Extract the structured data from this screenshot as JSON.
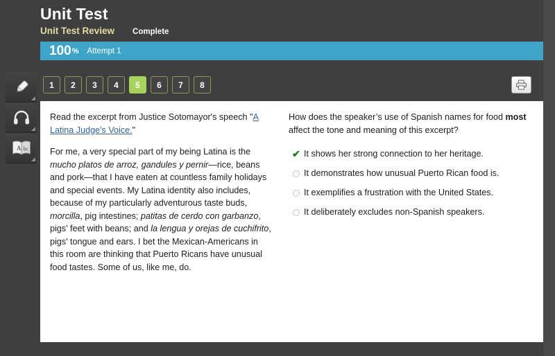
{
  "header": {
    "title": "Unit Test",
    "review_label": "Unit Test Review",
    "status": "Complete",
    "score": "100",
    "percent_symbol": "%",
    "attempt": "Attempt 1",
    "bar_color": "#3ea5c8",
    "review_color": "#e4dca4"
  },
  "tools": [
    {
      "name": "highlighter-tool",
      "label": "Highlighter"
    },
    {
      "name": "audio-tool",
      "label": "Text to speech"
    },
    {
      "name": "dictionary-tool",
      "label": "Dictionary"
    }
  ],
  "question_nav": {
    "items": [
      "1",
      "2",
      "3",
      "4",
      "5",
      "6",
      "7",
      "8"
    ],
    "active": "5",
    "active_color": "#a8d25e",
    "border_color": "#8f9a56"
  },
  "toolbar": {
    "print_label": "Print"
  },
  "passage": {
    "instruction_before": "Read the excerpt from Justice Sotomayor's speech \"",
    "link_text": "A Latina Judge's Voice.",
    "instruction_after": "\"",
    "body_parts": [
      {
        "text": "For me, a very special part of my being Latina is the ",
        "italic": false
      },
      {
        "text": "mucho platos de arroz, gandules y pernir",
        "italic": true
      },
      {
        "text": "—rice, beans and pork—that I have eaten at countless family holidays and special events. My Latina identity also includes, because of my particularly adventurous taste buds, ",
        "italic": false
      },
      {
        "text": "morcilla",
        "italic": true
      },
      {
        "text": ", pig intestines; ",
        "italic": false
      },
      {
        "text": "patitas de cerdo con garbanzo",
        "italic": true
      },
      {
        "text": ", pigs' feet with beans; and ",
        "italic": false
      },
      {
        "text": "la lengua y orejas de cuchifrito",
        "italic": true
      },
      {
        "text": ", pigs' tongue and ears. I bet the Mexican-Americans in this room are thinking that Puerto Ricans have unusual food tastes. Some of us, like me, do.",
        "italic": false
      }
    ]
  },
  "question": {
    "text_before": "How does the speaker’s use of Spanish names for food ",
    "emphasis": "most",
    "text_after": " affect the tone and meaning of this excerpt?",
    "options": [
      {
        "text": "It shows her strong connection to her heritage.",
        "state": "correct"
      },
      {
        "text": "It demonstrates how unusual Puerto Rican food is.",
        "state": "unselected"
      },
      {
        "text": "It exemplifies a frustration with the United States.",
        "state": "unselected"
      },
      {
        "text": "It deliberately excludes non-Spanish speakers.",
        "state": "unselected"
      }
    ],
    "correct_color": "#1f7a23"
  }
}
